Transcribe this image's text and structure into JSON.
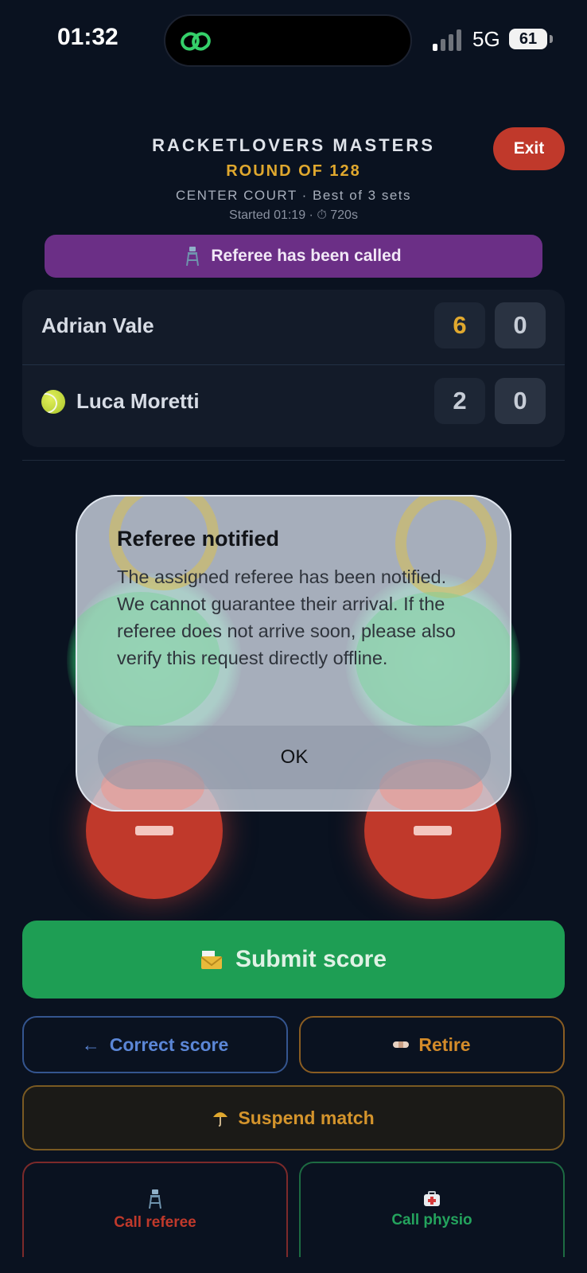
{
  "status_bar": {
    "time": "01:32",
    "network": "5G",
    "battery": "61"
  },
  "header": {
    "tournament": "RACKETLOVERS MASTERS",
    "round": "ROUND OF 128",
    "court_info": "CENTER COURT · Best of 3 sets",
    "started_info": "Started 01:19 · ⏱ 720s",
    "exit_label": "Exit"
  },
  "banner": {
    "text": "Referee has been called",
    "icon": "referee-chair-icon"
  },
  "scoreboard": {
    "players": [
      {
        "name": "Adrian Vale",
        "serving": false,
        "sets": [
          "6",
          "0"
        ]
      },
      {
        "name": "Luca Moretti",
        "serving": true,
        "sets": [
          "2",
          "0"
        ]
      }
    ]
  },
  "modal": {
    "title": "Referee notified",
    "message": "The assigned referee has been notified. We cannot guarantee their arrival. If the referee does not arrive soon, please also verify this request directly offline.",
    "ok_label": "OK"
  },
  "actions": {
    "submit_label": "Submit score",
    "correct_label": "Correct score",
    "retire_label": "Retire",
    "suspend_label": "Suspend match",
    "call_referee_label": "Call referee",
    "call_physio_label": "Call physio"
  },
  "colors": {
    "background": "#0a1220",
    "accent_gold": "#e0a82e",
    "exit_red": "#c0392b",
    "banner_purple": "#6b2f86",
    "submit_green": "#1e9e54"
  }
}
